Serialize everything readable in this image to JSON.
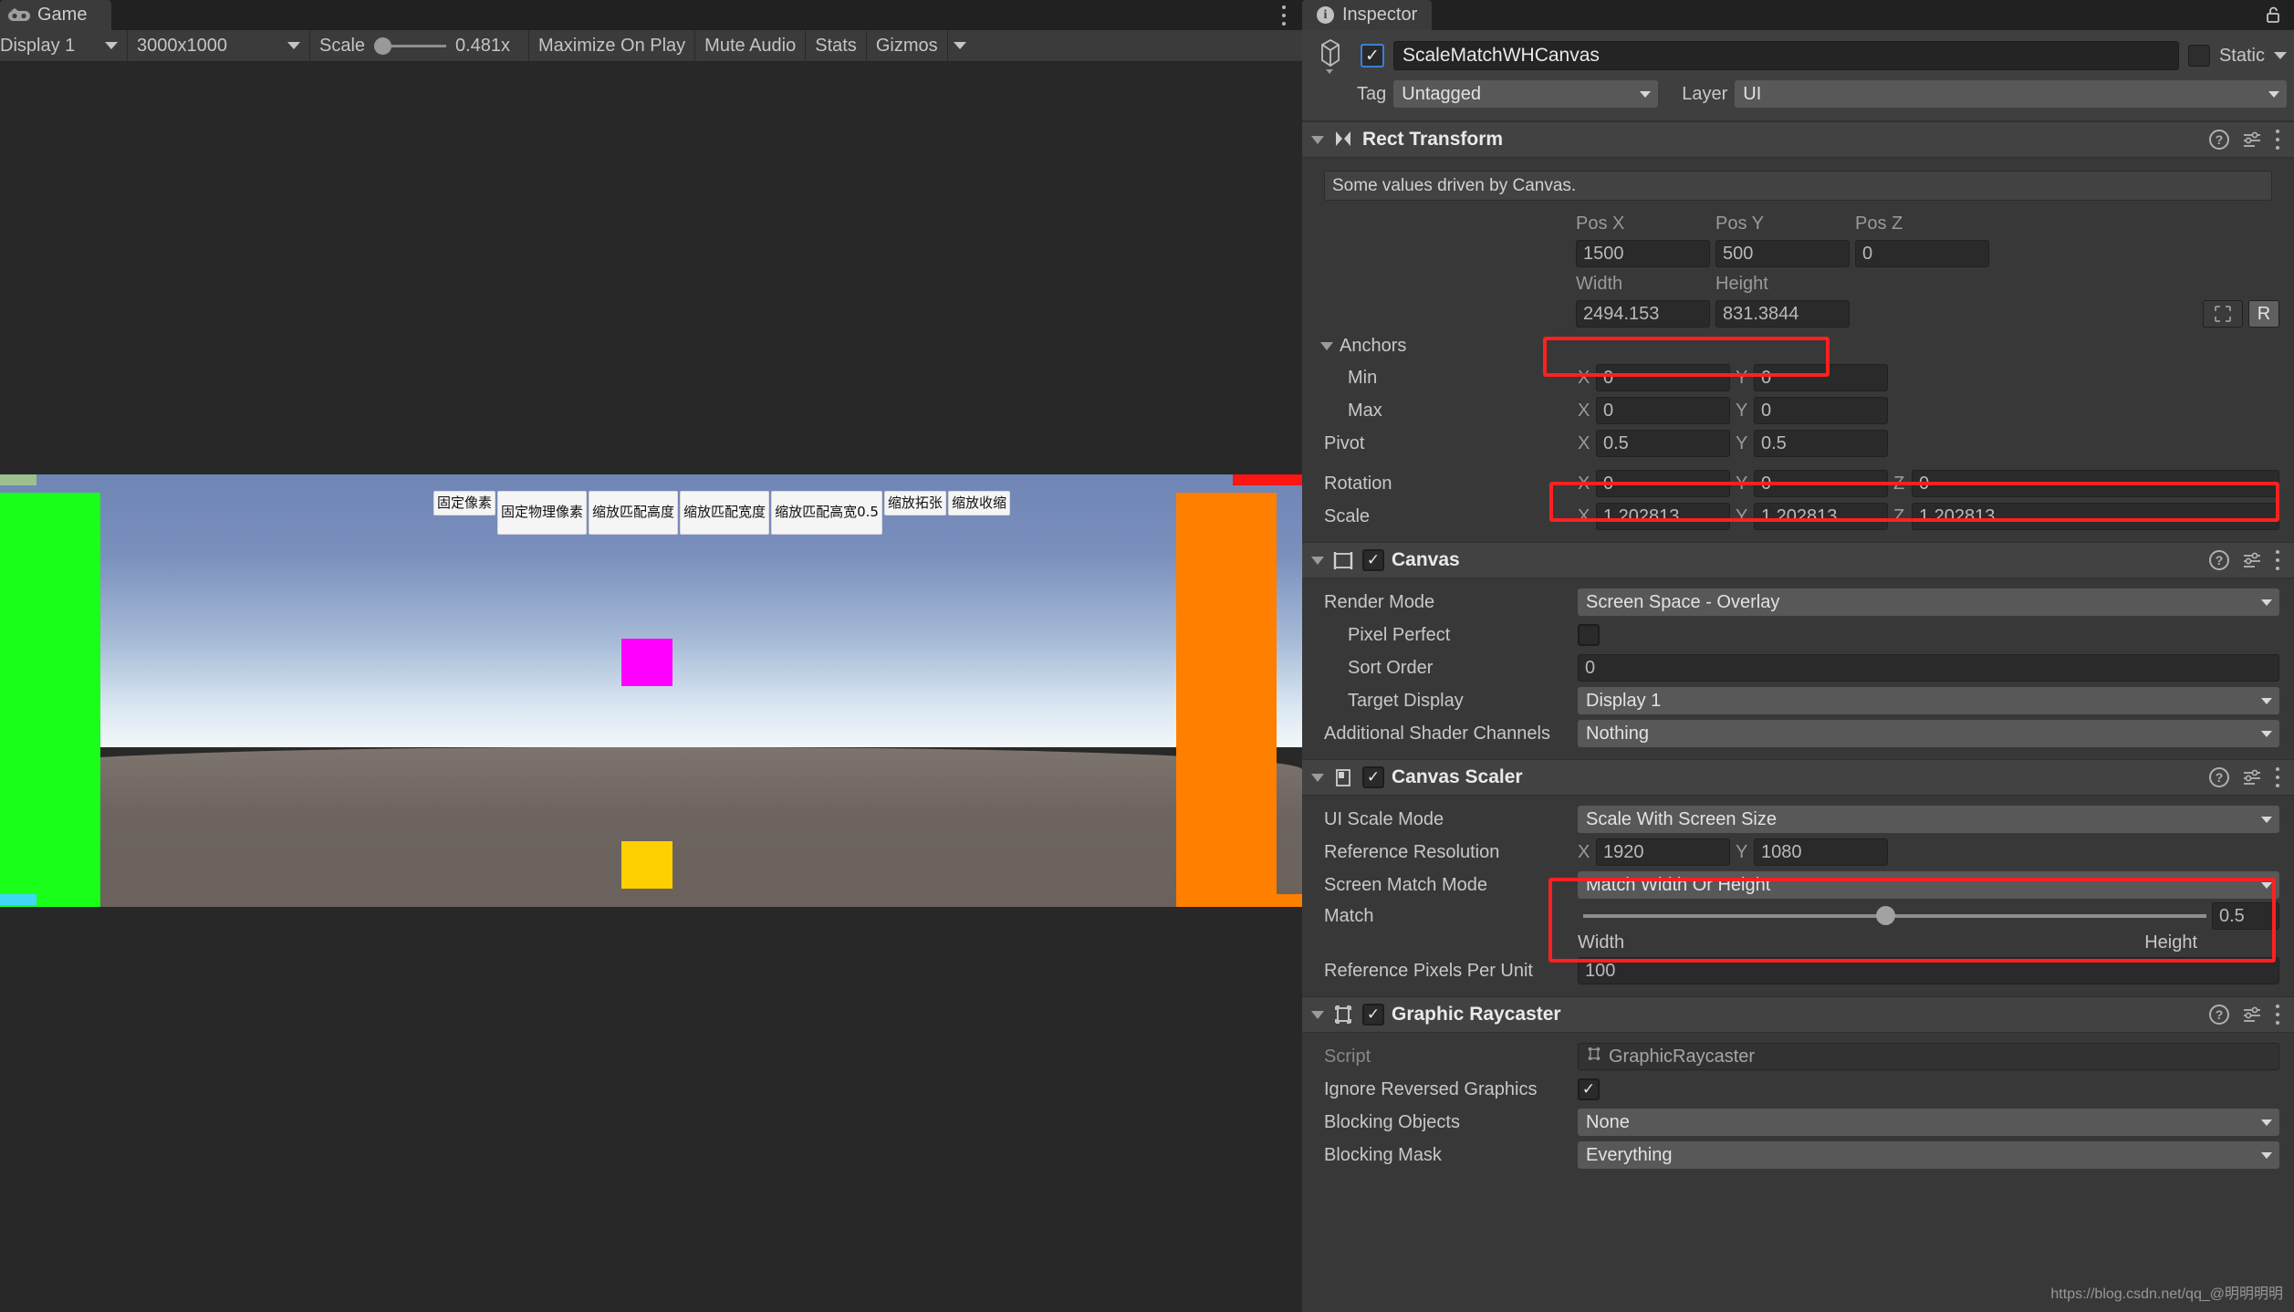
{
  "game_panel": {
    "tab_label": "Game",
    "tab_icon": "gamepad-icon",
    "toolbar": {
      "display": "Display 1",
      "resolution": "3000x1000",
      "scale_label": "Scale",
      "scale_value": "0.481x",
      "maximize_on_play": "Maximize On Play",
      "mute_audio": "Mute Audio",
      "stats": "Stats",
      "gizmos": "Gizmos"
    },
    "ui_buttons": [
      "固定像素",
      "固定物理像素",
      "缩放匹配高度",
      "缩放匹配宽度",
      "缩放匹配高宽0.5",
      "缩放拓张",
      "缩放收缩"
    ],
    "colors": {
      "green_box": "#1aff1a",
      "orange_box": "#ff7f00",
      "magenta_box": "#ff00ff",
      "yellow_box": "#ffd000",
      "red_marker": "#ff1414",
      "cyan_marker": "#3fd8f5"
    }
  },
  "inspector": {
    "tab_label": "Inspector",
    "object": {
      "name": "ScaleMatchWHCanvas",
      "enabled": true,
      "static_label": "Static",
      "tag_label": "Tag",
      "tag_value": "Untagged",
      "layer_label": "Layer",
      "layer_value": "UI"
    },
    "rect_transform": {
      "title": "Rect Transform",
      "notice": "Some values driven by Canvas.",
      "col_pos_x": "Pos X",
      "col_pos_y": "Pos Y",
      "col_pos_z": "Pos Z",
      "pos_x": "1500",
      "pos_y": "500",
      "pos_z": "0",
      "col_width": "Width",
      "col_height": "Height",
      "width": "2494.153",
      "height": "831.3844",
      "raw_label": "R",
      "anchors_label": "Anchors",
      "min_label": "Min",
      "min_x": "0",
      "min_y": "0",
      "max_label": "Max",
      "max_x": "0",
      "max_y": "0",
      "pivot_label": "Pivot",
      "pivot_x": "0.5",
      "pivot_y": "0.5",
      "rotation_label": "Rotation",
      "rot_x": "0",
      "rot_y": "0",
      "rot_z": "0",
      "scale_label": "Scale",
      "scale_x": "1.202813",
      "scale_y": "1.202813",
      "scale_z": "1.202813"
    },
    "canvas": {
      "title": "Canvas",
      "enabled": true,
      "render_mode_label": "Render Mode",
      "render_mode_value": "Screen Space - Overlay",
      "pixel_perfect_label": "Pixel Perfect",
      "pixel_perfect_value": false,
      "sort_order_label": "Sort Order",
      "sort_order_value": "0",
      "target_display_label": "Target Display",
      "target_display_value": "Display 1",
      "additional_shader_label": "Additional Shader Channels",
      "additional_shader_value": "Nothing"
    },
    "canvas_scaler": {
      "title": "Canvas Scaler",
      "enabled": true,
      "ui_scale_mode_label": "UI Scale Mode",
      "ui_scale_mode_value": "Scale With Screen Size",
      "ref_res_label": "Reference Resolution",
      "ref_res_x": "1920",
      "ref_res_y": "1080",
      "screen_match_label": "Screen Match Mode",
      "screen_match_value": "Match Width Or Height",
      "match_label": "Match",
      "match_value": "0.5",
      "match_min_label": "Width",
      "match_max_label": "Height",
      "ref_ppu_label": "Reference Pixels Per Unit",
      "ref_ppu_value": "100"
    },
    "graphic_raycaster": {
      "title": "Graphic Raycaster",
      "enabled": true,
      "script_label": "Script",
      "script_value": "GraphicRaycaster",
      "ignore_rev_label": "Ignore Reversed Graphics",
      "ignore_rev_value": true,
      "blocking_objects_label": "Blocking Objects",
      "blocking_objects_value": "None",
      "blocking_mask_label": "Blocking Mask",
      "blocking_mask_value": "Everything"
    },
    "watermark": "https://blog.csdn.net/qq_@明明明明"
  }
}
